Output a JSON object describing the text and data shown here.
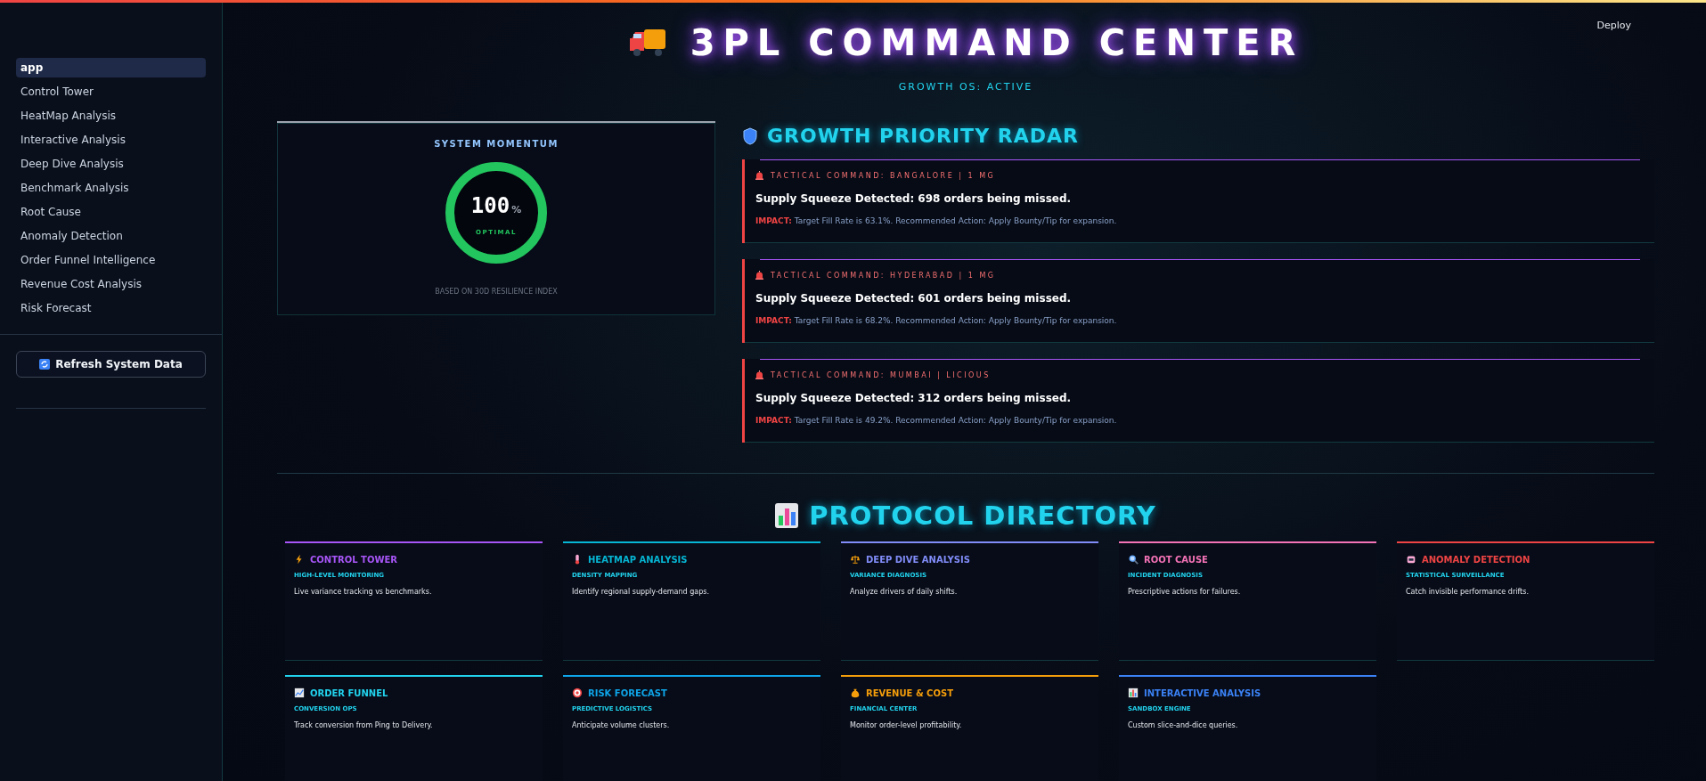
{
  "sidebar": {
    "items": [
      {
        "label": "app",
        "selected": true
      },
      {
        "label": "Control Tower",
        "selected": false
      },
      {
        "label": "HeatMap Analysis",
        "selected": false
      },
      {
        "label": "Interactive Analysis",
        "selected": false
      },
      {
        "label": "Deep Dive Analysis",
        "selected": false
      },
      {
        "label": "Benchmark Analysis",
        "selected": false
      },
      {
        "label": "Root Cause",
        "selected": false
      },
      {
        "label": "Anomaly Detection",
        "selected": false
      },
      {
        "label": "Order Funnel Intelligence",
        "selected": false
      },
      {
        "label": "Revenue Cost Analysis",
        "selected": false
      },
      {
        "label": "Risk Forecast",
        "selected": false
      }
    ],
    "refresh_button": "Refresh System Data"
  },
  "toolbar": {
    "deploy": "Deploy"
  },
  "header": {
    "title": "3PL COMMAND CENTER",
    "subtitle": "GROWTH OS: ACTIVE"
  },
  "momentum": {
    "title": "SYSTEM MOMENTUM",
    "value": "100",
    "unit": "%",
    "status": "OPTIMAL",
    "level": 1.0,
    "footnote": "BASED ON 30D RESILIENCE INDEX"
  },
  "radar": {
    "title": "GROWTH PRIORITY RADAR",
    "alerts": [
      {
        "label": "TACTICAL COMMAND: BANGALORE | 1 MG",
        "headline": "Supply Squeeze Detected: 698 orders being missed.",
        "detail": "**IMPACT:** Target Fill Rate is 63.1%. Recommended Action: Apply Bounty/Tip for expansion."
      },
      {
        "label": "TACTICAL COMMAND: HYDERABAD | 1 MG",
        "headline": "Supply Squeeze Detected: 601 orders being missed.",
        "detail": "**IMPACT:** Target Fill Rate is 68.2%. Recommended Action: Apply Bounty/Tip for expansion."
      },
      {
        "label": "TACTICAL COMMAND: MUMBAI | LICIOUS",
        "headline": "Supply Squeeze Detected: 312 orders being missed.",
        "detail": "**IMPACT:** Target Fill Rate is 49.2%. Recommended Action: Apply Bounty/Tip for expansion."
      }
    ]
  },
  "directory": {
    "title": "PROTOCOL DIRECTORY",
    "cards": [
      {
        "title": "CONTROL TOWER",
        "subtitle": "HIGH-LEVEL MONITORING",
        "description": "Live variance tracking vs benchmarks.",
        "color": "#a855f7"
      },
      {
        "title": "HEATMAP ANALYSIS",
        "subtitle": "DENSITY MAPPING",
        "description": "Identify regional supply-demand gaps.",
        "color": "#06b6d4"
      },
      {
        "title": "DEEP DIVE ANALYSIS",
        "subtitle": "VARIANCE DIAGNOSIS",
        "description": "Analyze drivers of daily shifts.",
        "color": "#818cf8"
      },
      {
        "title": "ROOT CAUSE",
        "subtitle": "INCIDENT DIAGNOSIS",
        "description": "Prescriptive actions for failures.",
        "color": "#f472b6"
      },
      {
        "title": "ANOMALY DETECTION",
        "subtitle": "STATISTICAL SURVEILLANCE",
        "description": "Catch invisible performance drifts.",
        "color": "#ef4444"
      },
      {
        "title": "ORDER FUNNEL",
        "subtitle": "CONVERSION OPS",
        "description": "Track conversion from Ping to Delivery.",
        "color": "#22d3ee"
      },
      {
        "title": "RISK FORECAST",
        "subtitle": "PREDICTIVE LOGISTICS",
        "description": "Anticipate volume clusters.",
        "color": "#0ea5e9"
      },
      {
        "title": "REVENUE & COST",
        "subtitle": "FINANCIAL CENTER",
        "description": "Monitor order-level profitability.",
        "color": "#f59e0b"
      },
      {
        "title": "INTERACTIVE ANALYSIS",
        "subtitle": "SANDBOX ENGINE",
        "description": "Custom slice-and-dice queries.",
        "color": "#3b82f6"
      }
    ]
  }
}
